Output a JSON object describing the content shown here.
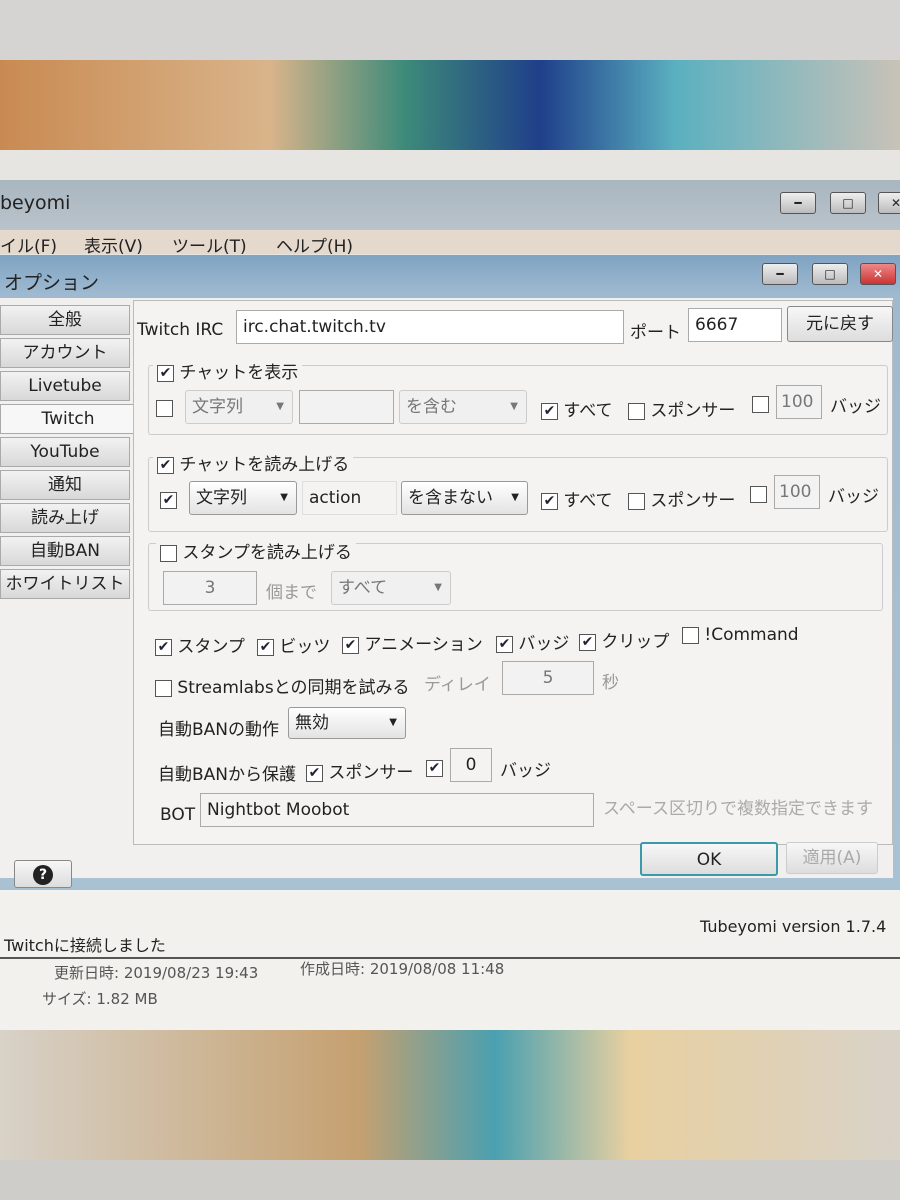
{
  "main_window": {
    "title": "beyomi",
    "menu": [
      "イル(F)",
      "表示(V)",
      "ツール(T)",
      "ヘルプ(H)"
    ]
  },
  "dialog": {
    "title": "オプション",
    "tabs": [
      {
        "label": "全般"
      },
      {
        "label": "アカウント"
      },
      {
        "label": "Livetube"
      },
      {
        "label": "Twitch",
        "active": true
      },
      {
        "label": "YouTube"
      },
      {
        "label": "通知"
      },
      {
        "label": "読み上げ"
      },
      {
        "label": "自動BAN"
      },
      {
        "label": "ホワイトリスト"
      }
    ],
    "irc_label": "Twitch IRC",
    "irc_value": "irc.chat.twitch.tv",
    "port_label": "ポート",
    "port_value": "6667",
    "reset_label": "元に戻す",
    "show_chat": {
      "label": "チャットを表示",
      "checked": true,
      "filter_checked": false,
      "type": "文字列",
      "text": "",
      "condition": "を含む",
      "all_label": "すべて",
      "all_checked": true,
      "sponsor_label": "スポンサー",
      "sponsor_checked": false,
      "badge_checked": false,
      "badge_value": "100",
      "badge_label": "バッジ"
    },
    "read_chat": {
      "label": "チャットを読み上げる",
      "checked": true,
      "filter_checked": true,
      "type": "文字列",
      "text": "action",
      "condition": "を含まない",
      "all_label": "すべて",
      "all_checked": true,
      "sponsor_label": "スポンサー",
      "sponsor_checked": false,
      "badge_checked": false,
      "badge_value": "100",
      "badge_label": "バッジ"
    },
    "read_stamp": {
      "label": "スタンプを読み上げる",
      "checked": false,
      "count": "3",
      "count_label": "個まで",
      "scope": "すべて"
    },
    "options": [
      {
        "label": "スタンプ",
        "checked": true
      },
      {
        "label": "ビッツ",
        "checked": true
      },
      {
        "label": "アニメーション",
        "checked": true
      },
      {
        "label": "バッジ",
        "checked": true
      },
      {
        "label": "クリップ",
        "checked": true
      },
      {
        "label": "!Command",
        "checked": false
      }
    ],
    "streamlabs": {
      "label": "Streamlabsとの同期を試みる",
      "checked": false,
      "delay_label": "ディレイ",
      "delay": "5",
      "unit": "秒"
    },
    "autoban_action": {
      "label": "自動BANの動作",
      "value": "無効"
    },
    "autoban_protect": {
      "label": "自動BANから保護",
      "sponsor_label": "スポンサー",
      "sponsor_checked": true,
      "badge_checked": true,
      "badge_value": "0",
      "badge_label": "バッジ"
    },
    "bot": {
      "label": "BOT",
      "value": "Nightbot Moobot",
      "hint": "スペース区切りで複数指定できます"
    },
    "ok_label": "OK",
    "apply_label": "適用(A)",
    "help_label": "?"
  },
  "status": {
    "message": "Twitchに接続しました",
    "version": "Tubeyomi version 1.7.4"
  },
  "file_info": {
    "modified": "更新日時: 2019/08/23 19:43",
    "created": "作成日時: 2019/08/08 11:48",
    "size": "サイズ: 1.82 MB"
  }
}
